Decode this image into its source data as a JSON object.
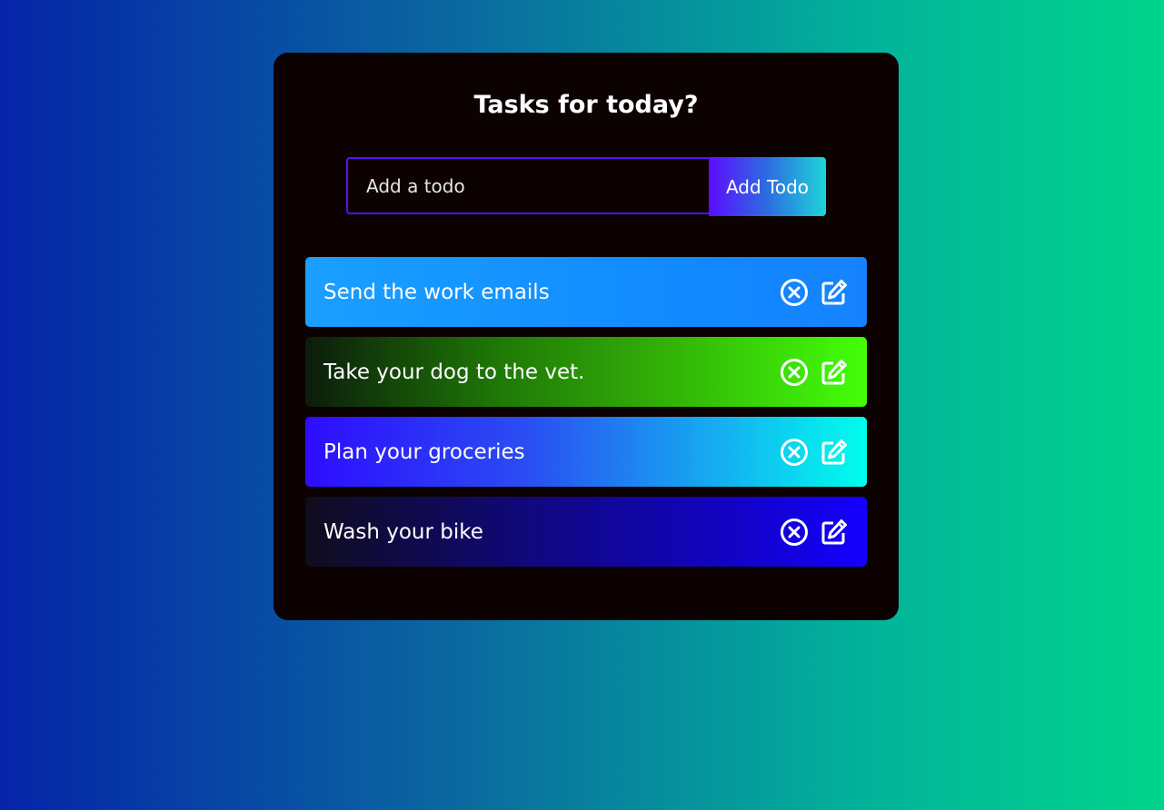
{
  "header": {
    "title": "Tasks for today?"
  },
  "form": {
    "input_placeholder": "Add a todo",
    "input_value": "",
    "button_label": "Add Todo"
  },
  "todos": [
    {
      "text": "Send the work emails",
      "delete_icon": "close-circle-icon",
      "edit_icon": "edit-icon"
    },
    {
      "text": "Take your dog to the vet.",
      "delete_icon": "close-circle-icon",
      "edit_icon": "edit-icon"
    },
    {
      "text": "Plan your groceries",
      "delete_icon": "close-circle-icon",
      "edit_icon": "edit-icon"
    },
    {
      "text": "Wash your bike",
      "delete_icon": "close-circle-icon",
      "edit_icon": "edit-icon"
    }
  ],
  "colors": {
    "app_background": "#0c0202",
    "accent": "#5d0cff",
    "text": "#ffffff"
  }
}
